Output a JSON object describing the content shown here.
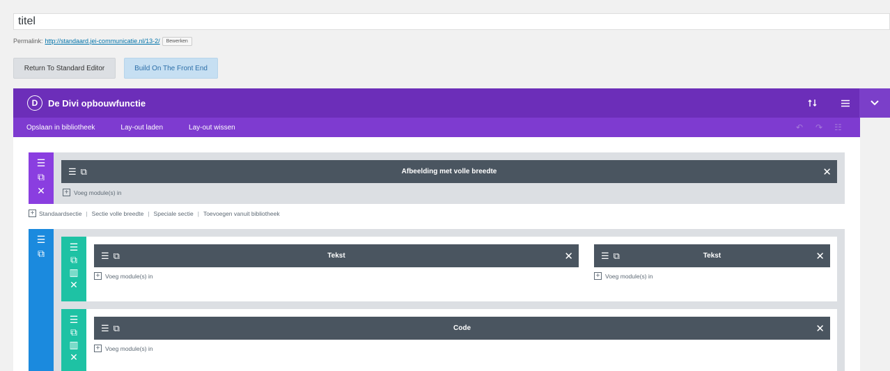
{
  "title_input": {
    "value": "titel"
  },
  "permalink": {
    "label": "Permalink:",
    "url": "http://standaard.jei-communicatie.nl/13-2/",
    "edit_label": "Bewerken"
  },
  "editor_buttons": {
    "standard": "Return To Standard Editor",
    "front_end": "Build On The Front End"
  },
  "builder": {
    "logo_letter": "D",
    "title": "De Divi opbouwfunctie",
    "header_icons": [
      "sort-icon",
      "menu-icon",
      "chevron-down-icon"
    ],
    "toolbar": [
      "Opslaan in bibliotheek",
      "Lay-out laden",
      "Lay-out wissen"
    ],
    "history_icons": [
      "undo-icon",
      "redo-icon",
      "history-icon"
    ]
  },
  "sections": [
    {
      "type": "fullwidth",
      "side_color": "#8a3ee0",
      "module": {
        "title": "Afbeelding met volle breedte"
      },
      "add_module_label": "Voeg module(s) in"
    },
    {
      "type": "standard",
      "side_color": "#1b8ade",
      "rows": [
        {
          "columns": [
            {
              "module": "Tekst",
              "add_module_label": "Voeg module(s) in"
            },
            {
              "module": "Tekst",
              "add_module_label": "Voeg module(s) in"
            }
          ]
        },
        {
          "columns": [
            {
              "module": "Code",
              "add_module_label": "Voeg module(s) in"
            }
          ]
        }
      ]
    }
  ],
  "section_links": [
    "Standaardsectie",
    "Sectie volle breedte",
    "Speciale sectie",
    "Toevoegen vanuit bibliotheek"
  ],
  "icons": {
    "hamburger": "☰",
    "duplicate": "⧉",
    "columns": "▥",
    "close": "✕",
    "plus": "+"
  },
  "colors": {
    "purple_header": "#6c2eb9",
    "purple_toolbar": "#7e3bd0",
    "section_purple": "#8a3ee0",
    "section_blue": "#1b8ade",
    "row_teal": "#1ec2a4",
    "module_bar": "#4a5560"
  }
}
